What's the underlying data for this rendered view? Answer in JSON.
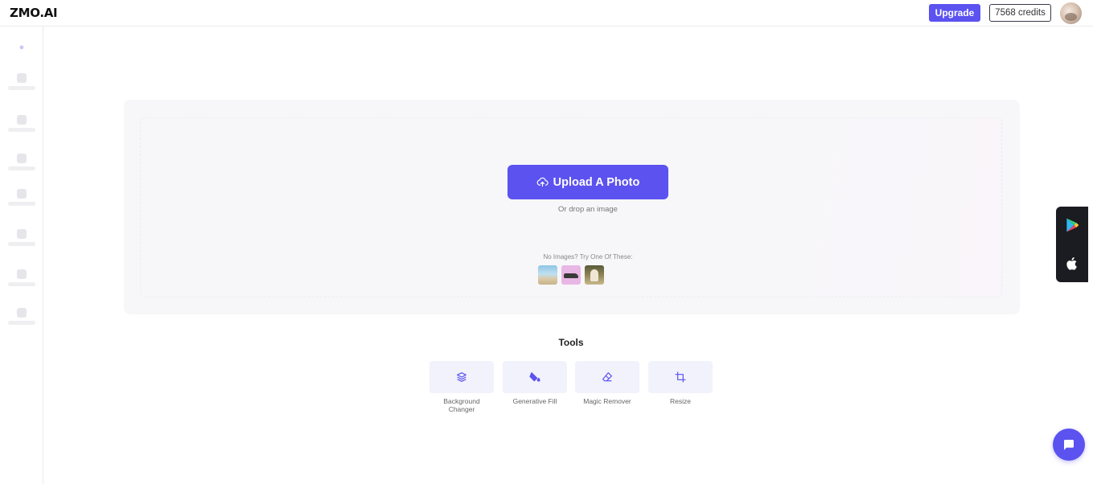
{
  "header": {
    "logo": "ZMO.AI",
    "upgrade_label": "Upgrade",
    "credits_label": "7568 credits"
  },
  "upload": {
    "button_label": "Upload A Photo",
    "drop_text": "Or drop an image",
    "try_text": "No Images? Try One Of These:"
  },
  "tools": {
    "title": "Tools",
    "items": [
      {
        "label": "Background Changer",
        "icon": "layers-icon"
      },
      {
        "label": "Generative Fill",
        "icon": "paint-bucket-icon"
      },
      {
        "label": "Magic Remover",
        "icon": "eraser-icon"
      },
      {
        "label": "Resize",
        "icon": "crop-icon"
      }
    ]
  },
  "colors": {
    "accent": "#5b52f0",
    "tool_bg": "#f2f2fc",
    "panel_bg": "#f7f7fa"
  }
}
